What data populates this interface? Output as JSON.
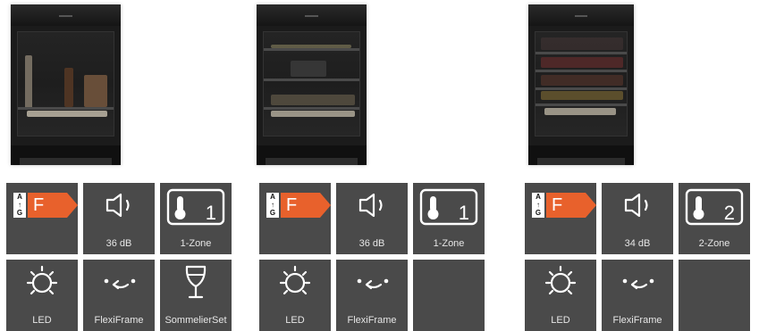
{
  "products": [
    {
      "name": "product-1",
      "tiles": [
        {
          "type": "energy",
          "class_label": "F",
          "scale": [
            "A",
            "↑",
            "G"
          ]
        },
        {
          "type": "noise",
          "label": "36 dB",
          "icon": "speaker-icon"
        },
        {
          "type": "zone",
          "label": "1-Zone",
          "zone_count": "1",
          "icon": "thermometer-icon"
        },
        {
          "type": "led",
          "label": "LED",
          "icon": "led-light-icon"
        },
        {
          "type": "flexiframe",
          "label": "FlexiFrame",
          "icon": "flexiframe-icon"
        },
        {
          "type": "sommelier",
          "label": "SommelierSet",
          "icon": "wine-glass-icon"
        }
      ]
    },
    {
      "name": "product-2",
      "tiles": [
        {
          "type": "energy",
          "class_label": "F",
          "scale": [
            "A",
            "↑",
            "G"
          ]
        },
        {
          "type": "noise",
          "label": "36 dB",
          "icon": "speaker-icon"
        },
        {
          "type": "zone",
          "label": "1-Zone",
          "zone_count": "1",
          "icon": "thermometer-icon"
        },
        {
          "type": "led",
          "label": "LED",
          "icon": "led-light-icon"
        },
        {
          "type": "flexiframe",
          "label": "FlexiFrame",
          "icon": "flexiframe-icon"
        },
        {
          "type": "empty"
        }
      ]
    },
    {
      "name": "product-3",
      "tiles": [
        {
          "type": "energy",
          "class_label": "F",
          "scale": [
            "A",
            "↑",
            "G"
          ]
        },
        {
          "type": "noise",
          "label": "34 dB",
          "icon": "speaker-icon"
        },
        {
          "type": "zone",
          "label": "2-Zone",
          "zone_count": "2",
          "icon": "thermometer-icon"
        },
        {
          "type": "led",
          "label": "LED",
          "icon": "led-light-icon"
        },
        {
          "type": "flexiframe",
          "label": "FlexiFrame",
          "icon": "flexiframe-icon"
        },
        {
          "type": "empty"
        }
      ]
    }
  ],
  "colors": {
    "tile_bg": "#4a4a4a",
    "energy_orange": "#e8612c",
    "icon_white": "#ffffff",
    "label_text": "#e6e6e6"
  }
}
